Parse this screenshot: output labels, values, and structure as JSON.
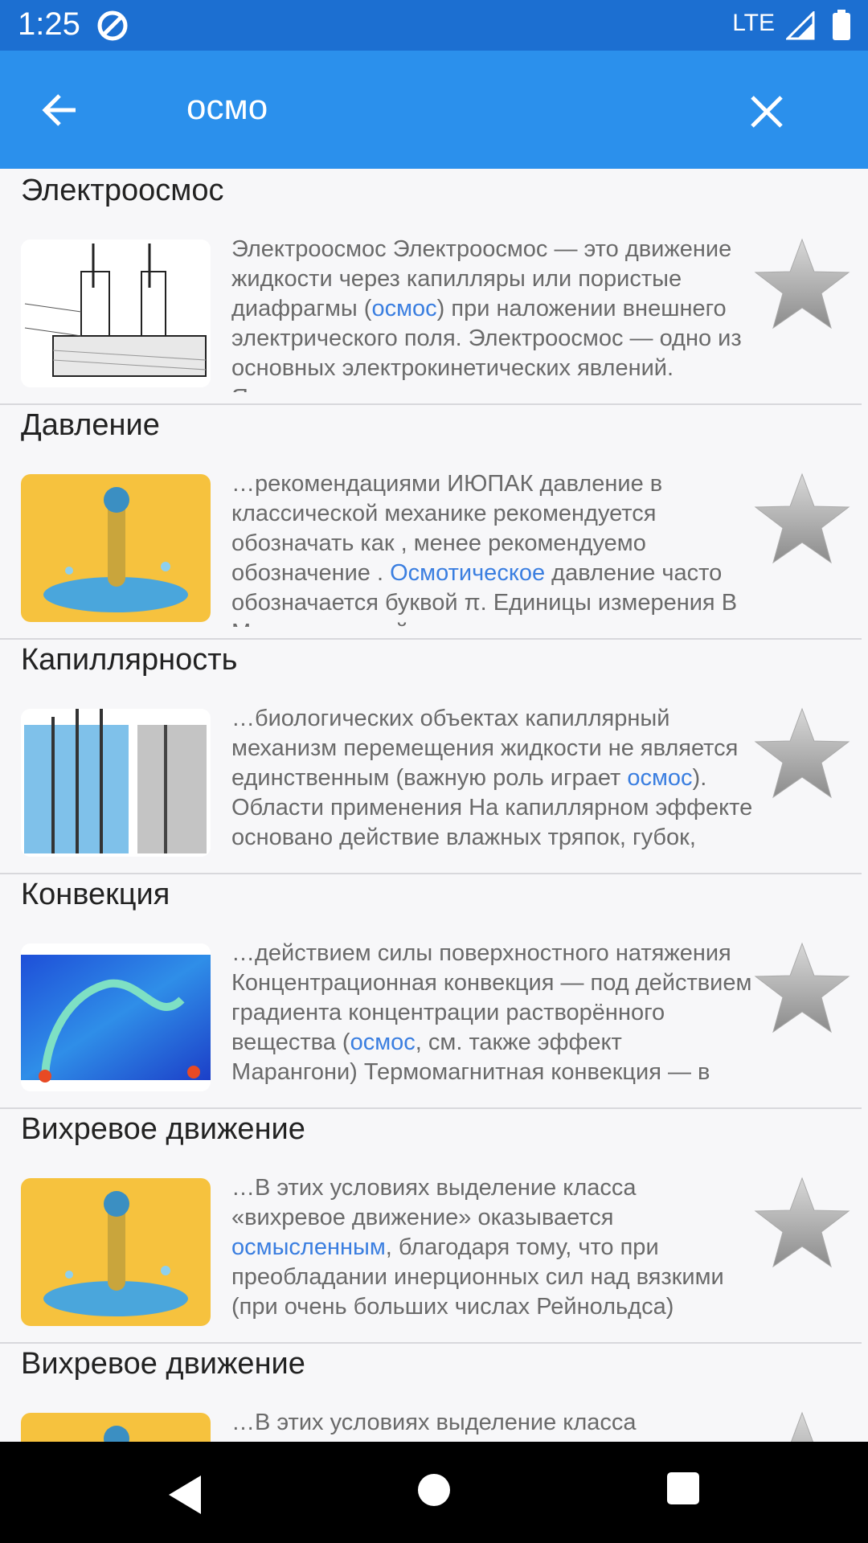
{
  "status_bar": {
    "time": "1:25",
    "network": "LTE"
  },
  "search": {
    "query": "осмо"
  },
  "results": [
    {
      "title": "Электроосмос",
      "thumb": "diagram",
      "snippet": [
        {
          "t": "Электроосмос Электроосмос — это движение жидкости через капилляры или пористые диафрагмы ("
        },
        {
          "t": "осмос",
          "hl": true
        },
        {
          "t": ") при наложении внешнего электрического поля. Электроосмос — одно из основных электрокинетических явлений. Явление"
        }
      ]
    },
    {
      "title": "Давление",
      "thumb": "splash",
      "snippet": [
        {
          "t": "…рекомендациями ИЮПАК давление в классической механике рекомендуется обозначать как , менее рекомендуемо обозначение . "
        },
        {
          "t": "Осмотическое",
          "hl": true
        },
        {
          "t": " давление часто обозначается буквой π. Единицы измерения В Международной системе"
        }
      ]
    },
    {
      "title": "Капиллярность",
      "thumb": "capillary",
      "snippet": [
        {
          "t": "…биологических объектах капиллярный механизм перемещения жидкости не является единственным (важную роль играет "
        },
        {
          "t": "осмос",
          "hl": true
        },
        {
          "t": "). Области применения На капиллярном эффекте основано действие влажных тряпок, губок, полотенец"
        }
      ]
    },
    {
      "title": "Конвекция",
      "thumb": "convection",
      "snippet": [
        {
          "t": "…действием силы поверхностного натяжения Концентрационная конвекция — под действием градиента концентрации растворённого вещества ("
        },
        {
          "t": "осмос",
          "hl": true
        },
        {
          "t": ", см. также эффект Марангони) Термомагнитная конвекция — в магнитных жидкостях под"
        }
      ]
    },
    {
      "title": "Вихревое движение",
      "thumb": "splash",
      "snippet": [
        {
          "t": "…В этих условиях выделение класса «вихревое движение» оказывается "
        },
        {
          "t": "осмысленным",
          "hl": true
        },
        {
          "t": ", благодаря тому, что при преобладании инерционных сил над вязкими (при очень больших числах Рейнольдса) типична локализация"
        }
      ]
    },
    {
      "title": "Вихревое движение",
      "thumb": "splash",
      "snippet": [
        {
          "t": "…В этих условиях выделение класса «вихревое движение» оказывается осмысленным"
        }
      ]
    }
  ]
}
